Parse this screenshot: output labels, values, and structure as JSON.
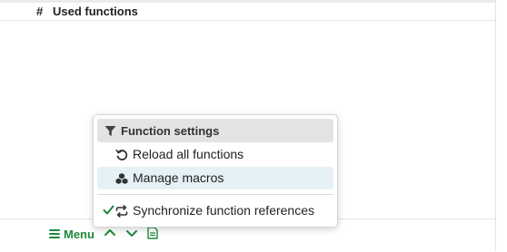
{
  "table": {
    "hash_header": "#",
    "used_header": "Used functions"
  },
  "popup": {
    "header": "Function settings",
    "items": [
      {
        "label": "Reload all functions",
        "icon": "reload-icon"
      },
      {
        "label": "Manage macros",
        "icon": "macros-icon"
      }
    ],
    "toggle": {
      "label": "Synchronize function references",
      "checked": true,
      "icon": "sync-icon"
    }
  },
  "footer": {
    "menu_label": "Menu"
  },
  "colors": {
    "accent": "#1e8a3c",
    "hover": "#e6f1f6",
    "header_bg": "#e3e3e3"
  }
}
